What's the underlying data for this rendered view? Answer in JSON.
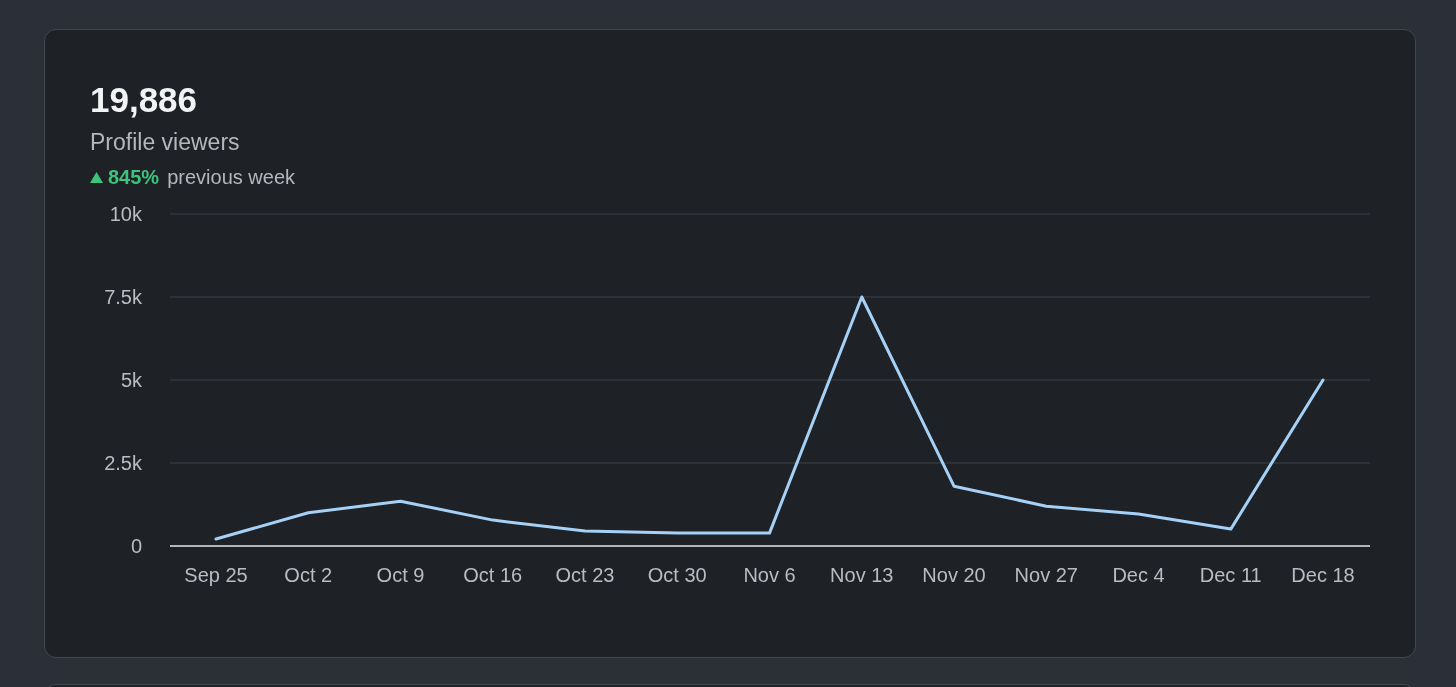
{
  "summary": {
    "value": "19,886",
    "label": "Profile viewers",
    "change": {
      "positive": true,
      "percent": "845%",
      "caption": "previous week"
    }
  },
  "chart_data": {
    "type": "line",
    "categories": [
      "Sep 25",
      "Oct 2",
      "Oct 9",
      "Oct 16",
      "Oct 23",
      "Oct 30",
      "Nov 6",
      "Nov 13",
      "Nov 20",
      "Nov 27",
      "Dec 4",
      "Dec 11",
      "Dec 18"
    ],
    "grid": true,
    "series": [
      {
        "color": "#a6d1f7",
        "values": [
          210,
          1000,
          1350,
          780,
          450,
          390,
          390,
          7500,
          1800,
          1200,
          960,
          510,
          5000
        ]
      }
    ],
    "ylim": [
      0,
      10000
    ],
    "yticks": [
      {
        "value": 0,
        "label": "0"
      },
      {
        "value": 2500,
        "label": "2.5k"
      },
      {
        "value": 5000,
        "label": "5k"
      },
      {
        "value": 7500,
        "label": "7.5k"
      },
      {
        "value": 10000,
        "label": "10k"
      }
    ]
  }
}
